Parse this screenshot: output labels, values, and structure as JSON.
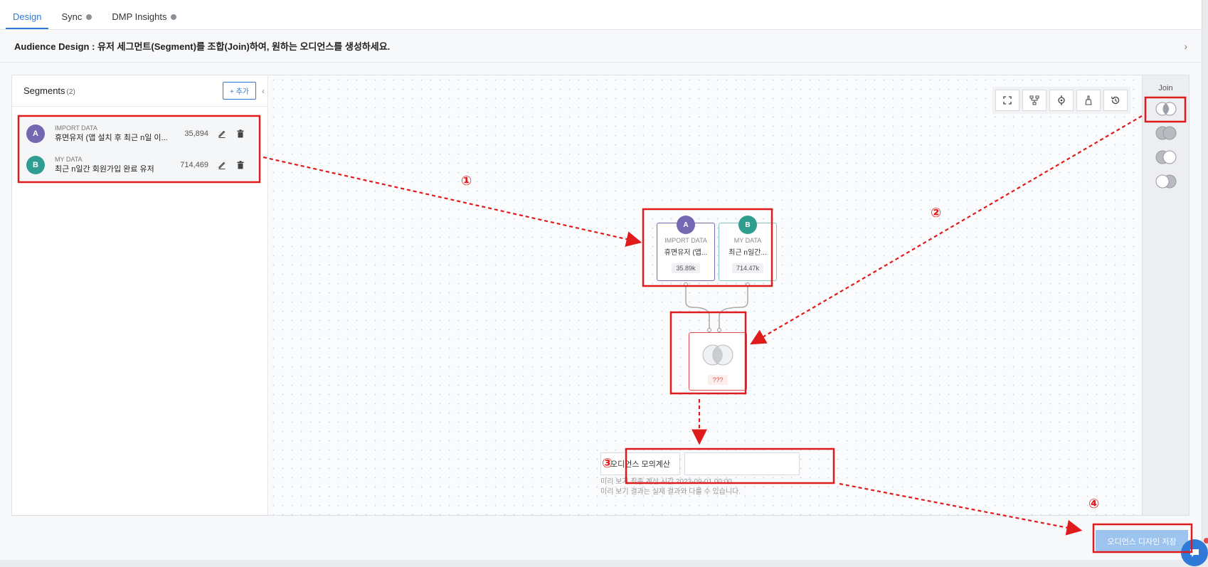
{
  "tabs": [
    {
      "label": "Design",
      "active": true
    },
    {
      "label": "Sync",
      "active": false
    },
    {
      "label": "DMP Insights",
      "active": false
    }
  ],
  "banner": {
    "text": "Audience Design : 유저 세그먼트(Segment)를 조합(Join)하여, 원하는 오디언스를 생성하세요."
  },
  "segments_panel": {
    "title": "Segments",
    "count": "(2)",
    "add_label": "+ 추가",
    "items": [
      {
        "badge": "A",
        "color": "#7567b1",
        "type": "IMPORT DATA",
        "name": "휴면유저 (앱 설치 후 최근 n일 이...",
        "count": "35,894"
      },
      {
        "badge": "B",
        "color": "#2f9e90",
        "type": "MY DATA",
        "name": "최근 n일간 회원가입 완료 유저",
        "count": "714,469"
      }
    ]
  },
  "canvas": {
    "nodes": [
      {
        "badge": "A",
        "color": "#7567b1",
        "type": "IMPORT DATA",
        "name": "휴면유저 (앱...",
        "count": "35.89k"
      },
      {
        "badge": "B",
        "color": "#2f9e90",
        "type": "MY DATA",
        "name": "최근 n일간...",
        "count": "714.47k"
      }
    ],
    "join_result": "???"
  },
  "join_panel": {
    "title": "Join"
  },
  "preview": {
    "button_label": "오디언스 모의계산",
    "field_value": "",
    "note_line1": "미리 보기 최종 계산 시간 2023-09-01 00:00",
    "note_line2": "미리 보기 결과는 실제 결과와 다를 수 있습니다."
  },
  "save_label": "오디언스 디자인 저장",
  "annotations": [
    "①",
    "②",
    "③",
    "④"
  ],
  "colors": {
    "accent": "#2f7ad9",
    "highlight": "#e01b1b"
  }
}
